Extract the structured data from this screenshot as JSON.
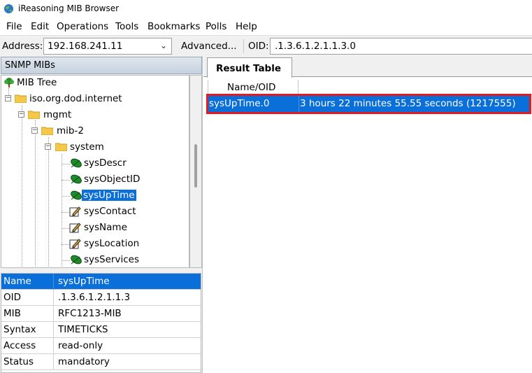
{
  "window": {
    "title": "iReasoning MIB Browser"
  },
  "menu": [
    "File",
    "Edit",
    "Operations",
    "Tools",
    "Bookmarks",
    "Polls",
    "Help"
  ],
  "address_bar": {
    "address_label": "Address:",
    "address_value": "192.168.241.11",
    "advanced_label": "Advanced...",
    "oid_label": "OID:",
    "oid_value": ".1.3.6.1.2.1.1.3.0"
  },
  "left_panel": {
    "title": "SNMP MIBs",
    "tree": [
      {
        "label": "MIB Tree",
        "icon": "tree-icon"
      },
      {
        "label": "iso.org.dod.internet",
        "icon": "folder-icon"
      },
      {
        "label": "mgmt",
        "icon": "folder-icon"
      },
      {
        "label": "mib-2",
        "icon": "folder-icon"
      },
      {
        "label": "system",
        "icon": "folder-icon"
      },
      {
        "label": "sysDescr",
        "icon": "leaf-icon"
      },
      {
        "label": "sysObjectID",
        "icon": "leaf-icon"
      },
      {
        "label": "sysUpTime",
        "icon": "leaf-icon",
        "selected": true
      },
      {
        "label": "sysContact",
        "icon": "writable-leaf-icon"
      },
      {
        "label": "sysName",
        "icon": "writable-leaf-icon"
      },
      {
        "label": "sysLocation",
        "icon": "writable-leaf-icon"
      },
      {
        "label": "sysServices",
        "icon": "leaf-icon"
      }
    ],
    "properties": [
      {
        "key": "Name",
        "value": "sysUpTime"
      },
      {
        "key": "OID",
        "value": ".1.3.6.1.2.1.1.3"
      },
      {
        "key": "MIB",
        "value": "RFC1213-MIB"
      },
      {
        "key": "Syntax",
        "value": "TIMETICKS"
      },
      {
        "key": "Access",
        "value": "read-only"
      },
      {
        "key": "Status",
        "value": "mandatory"
      }
    ]
  },
  "right_panel": {
    "tab_label": "Result Table",
    "columns": [
      "Name/OID"
    ],
    "rows": [
      {
        "name": "sysUpTime.0",
        "value": "3 hours 22 minutes 55.55 seconds (1217555)"
      }
    ]
  },
  "colors": {
    "selection": "#0a6fd8",
    "highlight_outline": "#e11b22"
  }
}
